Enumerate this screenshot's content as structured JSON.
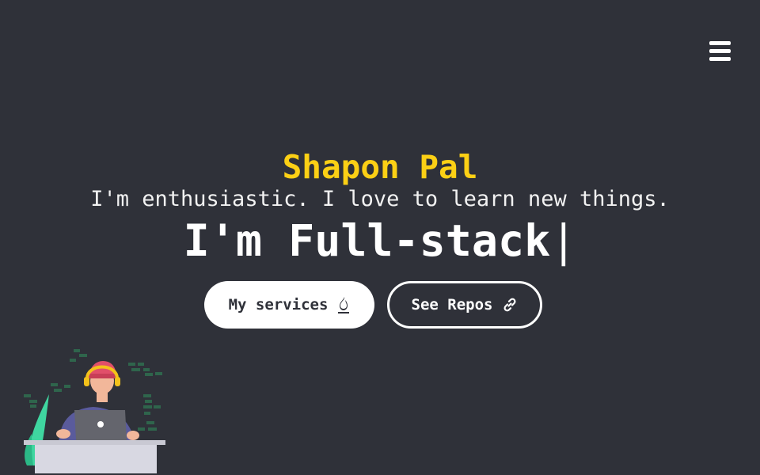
{
  "nav": {
    "menu_icon": "hamburger-menu-icon"
  },
  "hero": {
    "name": "Shapon Pal",
    "tagline": "I'm enthusiastic. I love to learn new things.",
    "typed_prefix": "I'm Full-stack",
    "cursor": "|"
  },
  "buttons": {
    "services_label": "My services",
    "services_icon": "fire-icon",
    "repos_label": "See Repos",
    "repos_icon": "link-icon"
  },
  "illustration": {
    "subject": "developer-at-laptop-illustration"
  },
  "colors": {
    "background": "#2f3139",
    "accent": "#fcd015",
    "text": "#ffffff"
  }
}
